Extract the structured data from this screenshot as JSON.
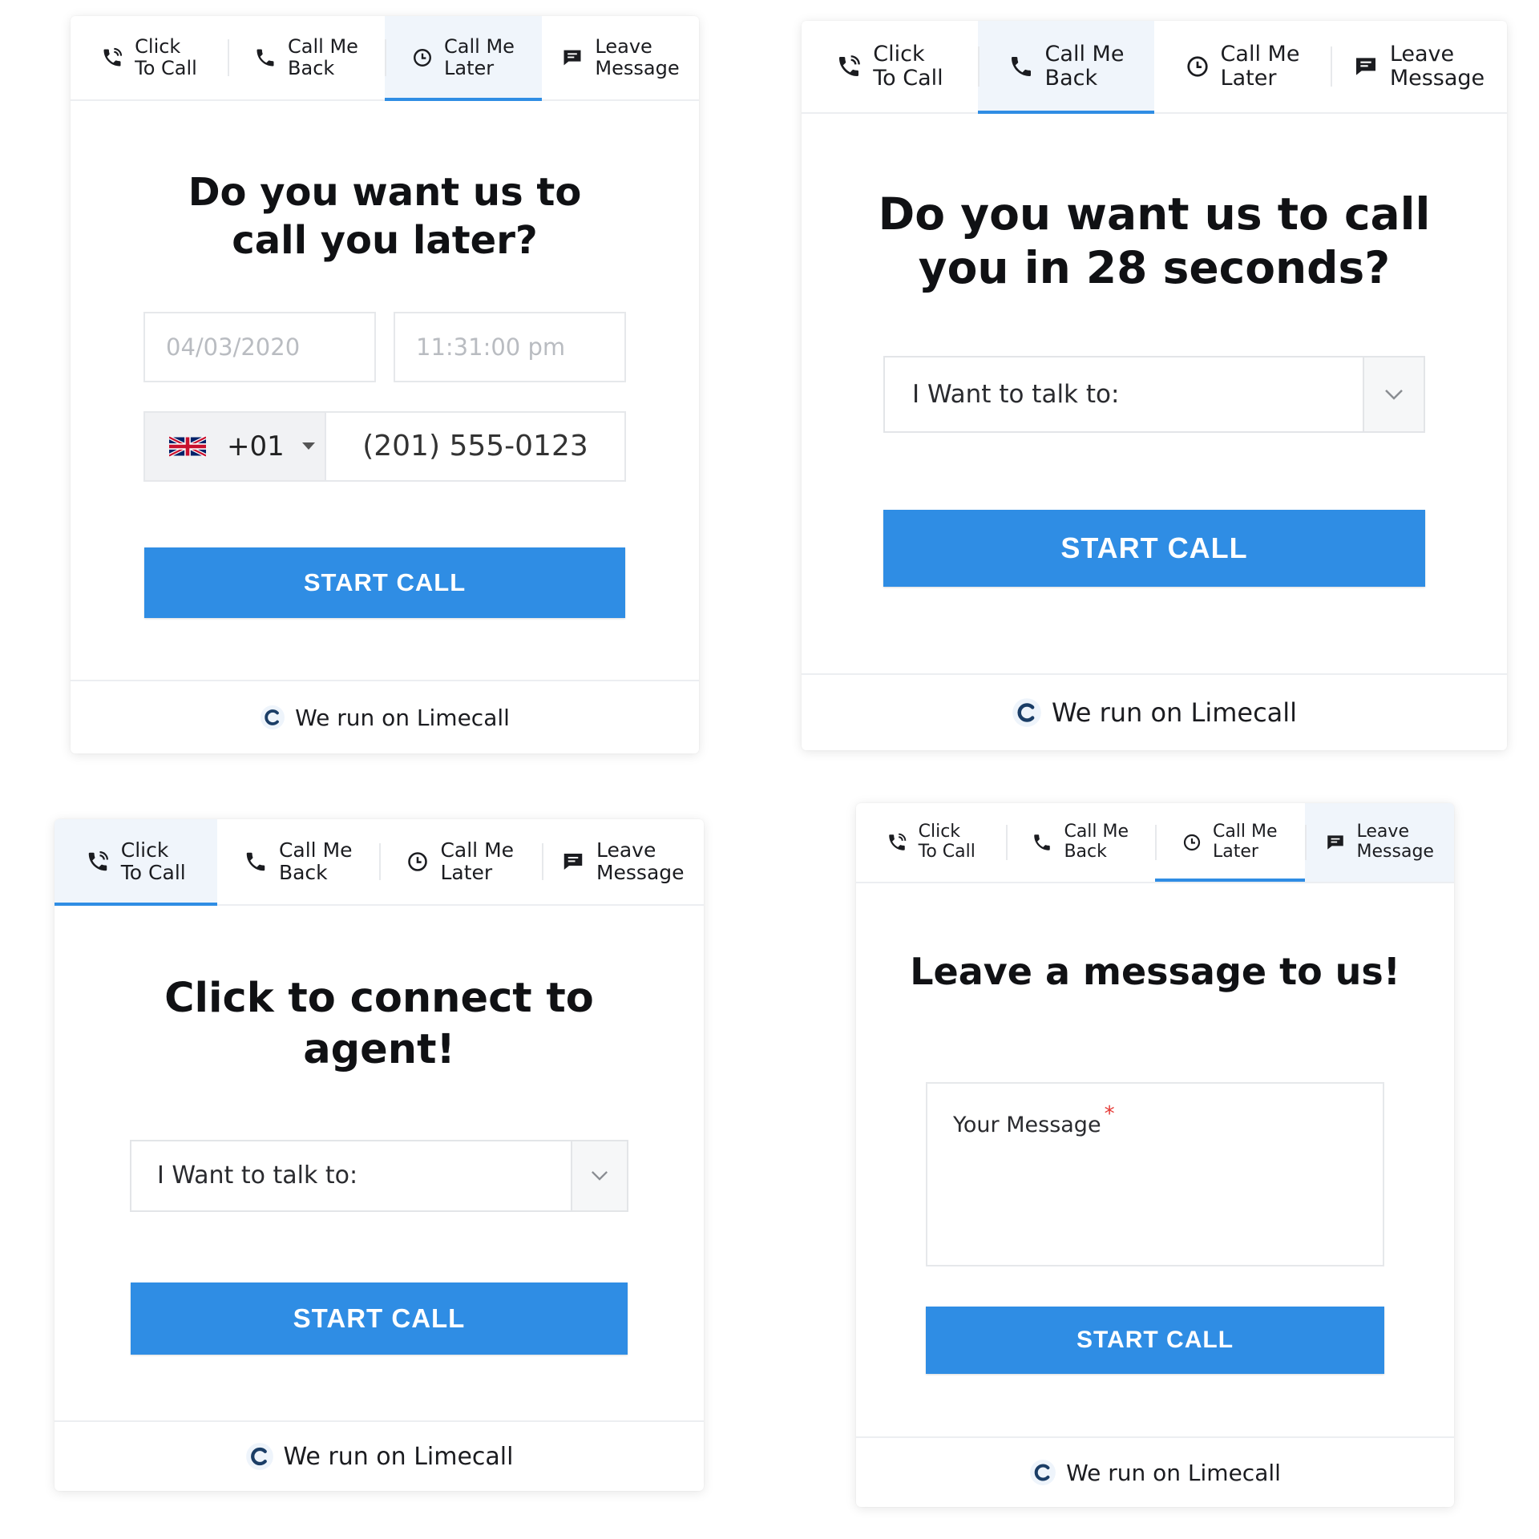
{
  "tabs": {
    "click_to_call": "Click\nTo Call",
    "call_me_back": "Call Me\nBack",
    "call_me_later": "Call Me\nLater",
    "leave_message": "Leave\nMessage"
  },
  "colors": {
    "accent": "#2f8de4",
    "required": "#e53935"
  },
  "icons": {
    "click_to_call": "phone-ringing-icon",
    "call_me_back": "phone-icon",
    "call_me_later": "clock-icon",
    "leave_message": "message-icon",
    "footer": "limecall-logo-icon",
    "select": "chevron-down-icon",
    "caret": "caret-down-icon",
    "flag": "uk-flag-icon"
  },
  "later_widget": {
    "active_tab": "call_me_later",
    "heading": "Do you want us to\ncall you later?",
    "date_placeholder": "04/03/2020",
    "time_placeholder": "11:31:00 pm",
    "country_code": "+01",
    "phone_value": "(201) 555-0123",
    "button": "START CALL",
    "footer": "We run on Limecall"
  },
  "back_widget": {
    "active_tab": "call_me_back",
    "heading": "Do you want us to call\nyou in 28 seconds?",
    "select_label": "I Want to talk to:",
    "button": "START CALL",
    "footer": "We run on Limecall"
  },
  "click_widget": {
    "active_tab": "click_to_call",
    "heading": "Click to connect to\nagent!",
    "select_label": "I Want to talk to:",
    "button": "START CALL",
    "footer": "We run on Limecall"
  },
  "message_widget": {
    "active_tab": "leave_message",
    "heading": "Leave a message to us!",
    "message_label": "Your Message",
    "required_mark": "*",
    "button": "START CALL",
    "footer": "We run on Limecall"
  }
}
